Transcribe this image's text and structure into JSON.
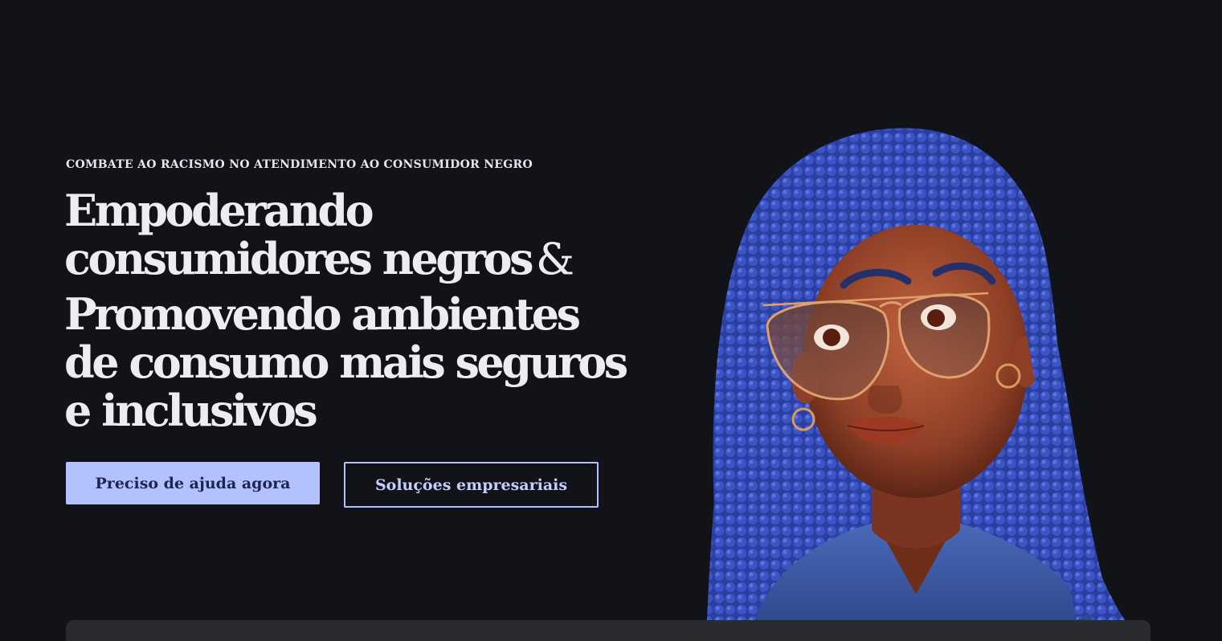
{
  "hero": {
    "eyebrow": "COMBATE AO RACISMO NO ATENDIMENTO AO CONSUMIDOR NEGRO",
    "headline": {
      "line1": "Empoderando",
      "line2": "consumidores negros",
      "ampersand": "&",
      "line3": "Promovendo ambientes",
      "line4": "de consumo mais seguros",
      "line5": "e inclusivos"
    },
    "buttons": {
      "primary_label": "Preciso de ajuda agora",
      "secondary_label": "Soluções empresariais"
    }
  },
  "colors": {
    "background": "#121318",
    "text": "#ececf3",
    "accent": "#b3c1ff",
    "accent_text": "#1e2550"
  }
}
